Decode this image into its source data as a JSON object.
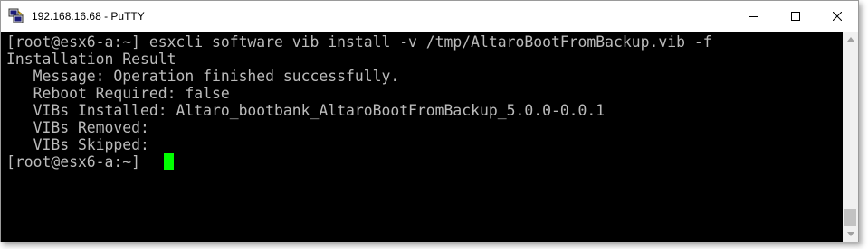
{
  "window": {
    "title": "192.168.16.68 - PuTTY",
    "app_icon": "putty-icon",
    "controls": {
      "minimize_icon": "minimize-icon",
      "maximize_icon": "maximize-icon",
      "close_icon": "close-icon"
    }
  },
  "terminal": {
    "lines": [
      "[root@esx6-a:~] esxcli software vib install -v /tmp/AltaroBootFromBackup.vib -f",
      "Installation Result",
      "   Message: Operation finished successfully.",
      "   Reboot Required: false",
      "   VIBs Installed: Altaro_bootbank_AltaroBootFromBackup_5.0.0-0.0.1",
      "   VIBs Removed:",
      "   VIBs Skipped:",
      "[root@esx6-a:~] "
    ],
    "background": "#000000",
    "text_color": "#bbbbbb",
    "cursor_color": "#00ff00"
  },
  "scrollbar": {
    "up_icon": "scroll-up-icon",
    "down_icon": "scroll-down-icon"
  }
}
